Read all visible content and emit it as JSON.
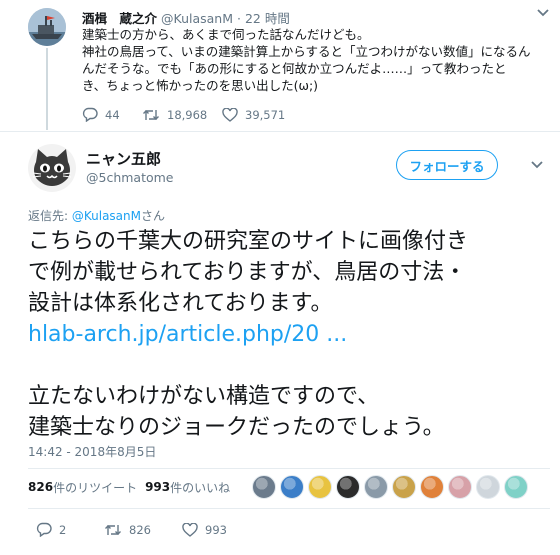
{
  "parent": {
    "display_name": "酒楫　蔵之介",
    "handle": "@KulasanM",
    "time": "22 時間",
    "lines": [
      "建築士の方から、あくまで伺った話なんだけども。",
      "神社の鳥居って、いまの建築計算上からすると「立つわけがない数値」になるん",
      "んだそうな。でも「あの形にすると何故か立つんだよ……」って教わったと",
      "き、ちょっと怖かったのを思い出した(ω;)"
    ],
    "reply_count": "44",
    "retweet_count": "18,968",
    "like_count": "39,571"
  },
  "main": {
    "display_name": "ニャン五郎",
    "handle": "@5chmatome",
    "follow_label": "フォローする",
    "replying_prefix": "返信先: ",
    "replying_mention": "@KulasanM",
    "replying_suffix": "さん",
    "text_lines": [
      "こちらの千葉大の研究室のサイトに画像付き",
      "で例が載せられておりますが、鳥居の寸法・",
      "設計は体系化されております。"
    ],
    "link": "hlab-arch.jp/article.php/20 ...",
    "text_lines_2": [
      "立たないわけがない構造ですので、",
      "建築士なりのジョークだったのでしょう。"
    ],
    "timestamp": "14:42 - 2018年8月5日",
    "retweets_num": "826",
    "retweets_label": "件のリツイート",
    "likes_num": "993",
    "likes_label": "件のいいね",
    "reply_count": "2",
    "retweet_count": "826",
    "like_count": "993"
  },
  "colors": {
    "accent": "#1da1f2",
    "secondary_text": "#657786",
    "divider": "#e6ecf0"
  },
  "liker_avatars": [
    "#6b7b8c",
    "#3b7ec8",
    "#e8c340",
    "#2b2b2b",
    "#8a9aa8",
    "#c9a24a",
    "#e0813a",
    "#d7a1a8",
    "#cfd6dc",
    "#7fd1c7"
  ]
}
